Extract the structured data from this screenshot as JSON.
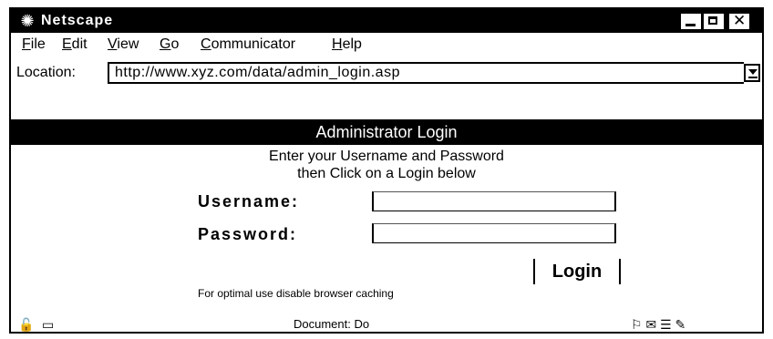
{
  "window": {
    "title": "Netscape",
    "app_icon": "netscape-logo-icon"
  },
  "menu": {
    "items": [
      {
        "label": "File",
        "mnemonic": "F"
      },
      {
        "label": "Edit",
        "mnemonic": "E"
      },
      {
        "label": "View",
        "mnemonic": "V"
      },
      {
        "label": "Go",
        "mnemonic": "G"
      },
      {
        "label": "Communicator",
        "mnemonic": "C"
      },
      {
        "label": "Help",
        "mnemonic": "H"
      }
    ]
  },
  "location": {
    "label": "Location:",
    "url": "http://www.xyz.com/data/admin_login.asp"
  },
  "page": {
    "header": "Administrator Login",
    "instruction_line1": "Enter your Username and Password",
    "instruction_line2": "then Click on a Login below",
    "username_label": "Username:",
    "username_value": "",
    "password_label": "Password:",
    "password_value": "",
    "login_button": "Login",
    "note": "For optimal use disable browser caching"
  },
  "status": {
    "text": "Document: Do",
    "icons": [
      "security-icon",
      "connection-icon",
      "component-bar-icons"
    ]
  }
}
